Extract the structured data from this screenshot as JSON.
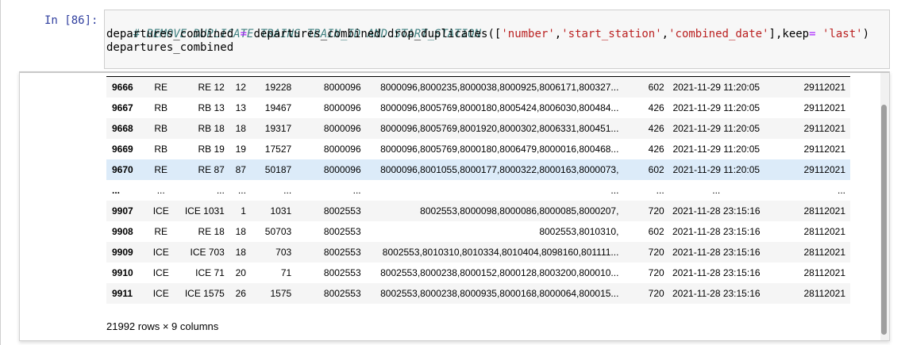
{
  "cell": {
    "prompt": "In [86]:",
    "code": {
      "comment": "# REMOVE DUPLICATE TRAINS TRAIN_ID AND START_STATION",
      "line2_var": "departures_combined",
      "line2_op": "=",
      "line2_call": "departures_combined.drop_duplicates([",
      "str_number": "'number'",
      "comma": ",",
      "str_start_station": "'start_station'",
      "str_combined_date": "'combined_date'",
      "line2_keep": "],keep",
      "str_last": "'last'",
      "close_paren": ")",
      "line3": "departures_combined"
    }
  },
  "table": {
    "rows": [
      {
        "idx": "9666",
        "c1": "RE",
        "c2": "RE 12",
        "c3": "12",
        "c4": "19228",
        "c5": "8000096",
        "c6": "8000096,8000235,8000038,8000925,8006171,800327...",
        "c7": "602",
        "c8": "2021-11-29 11:20:05",
        "c9": "29112021"
      },
      {
        "idx": "9667",
        "c1": "RB",
        "c2": "RB 13",
        "c3": "13",
        "c4": "19467",
        "c5": "8000096",
        "c6": "8000096,8005769,8000180,8005424,8006030,800484...",
        "c7": "426",
        "c8": "2021-11-29 11:20:05",
        "c9": "29112021"
      },
      {
        "idx": "9668",
        "c1": "RB",
        "c2": "RB 18",
        "c3": "18",
        "c4": "19317",
        "c5": "8000096",
        "c6": "8000096,8005769,8001920,8000302,8006331,800451...",
        "c7": "426",
        "c8": "2021-11-29 11:20:05",
        "c9": "29112021"
      },
      {
        "idx": "9669",
        "c1": "RB",
        "c2": "RB 19",
        "c3": "19",
        "c4": "17527",
        "c5": "8000096",
        "c6": "8000096,8005769,8000180,8006479,8000016,800468...",
        "c7": "426",
        "c8": "2021-11-29 11:20:05",
        "c9": "29112021"
      },
      {
        "idx": "9670",
        "c1": "RE",
        "c2": "RE 87",
        "c3": "87",
        "c4": "50187",
        "c5": "8000096",
        "c6": "8000096,8001055,8000177,8000322,8000163,8000073,",
        "c7": "602",
        "c8": "2021-11-29 11:20:05",
        "c9": "29112021"
      },
      {
        "idx": "...",
        "c1": "...",
        "c2": "...",
        "c3": "...",
        "c4": "...",
        "c5": "...",
        "c6": "...",
        "c7": "...",
        "c8": "...",
        "c9": "..."
      },
      {
        "idx": "9907",
        "c1": "ICE",
        "c2": "ICE 1031",
        "c3": "1",
        "c4": "1031",
        "c5": "8002553",
        "c6": "8002553,8000098,8000086,8000085,8000207,",
        "c7": "720",
        "c8": "2021-11-28 23:15:16",
        "c9": "28112021"
      },
      {
        "idx": "9908",
        "c1": "RE",
        "c2": "RE 18",
        "c3": "18",
        "c4": "50703",
        "c5": "8002553",
        "c6": "8002553,8010310,",
        "c7": "602",
        "c8": "2021-11-28 23:15:16",
        "c9": "28112021"
      },
      {
        "idx": "9909",
        "c1": "ICE",
        "c2": "ICE 703",
        "c3": "18",
        "c4": "703",
        "c5": "8002553",
        "c6": "8002553,8010310,8010334,8010404,8098160,801111...",
        "c7": "720",
        "c8": "2021-11-28 23:15:16",
        "c9": "28112021"
      },
      {
        "idx": "9910",
        "c1": "ICE",
        "c2": "ICE 71",
        "c3": "20",
        "c4": "71",
        "c5": "8002553",
        "c6": "8002553,8000238,8000152,8000128,8003200,800010...",
        "c7": "720",
        "c8": "2021-11-28 23:15:16",
        "c9": "28112021"
      },
      {
        "idx": "9911",
        "c1": "ICE",
        "c2": "ICE 1575",
        "c3": "26",
        "c4": "1575",
        "c5": "8002553",
        "c6": "8002553,8000238,8000935,8000168,8000064,800015...",
        "c7": "720",
        "c8": "2021-11-28 23:15:16",
        "c9": "28112021"
      }
    ],
    "shape": "21992 rows × 9 columns"
  },
  "colors": {
    "prompt": "#303f9f",
    "comment": "#408080",
    "string": "#ba2121",
    "operator": "#aa22ff",
    "row_stripe": "#f5f5f5",
    "row_hover": "#dcebf9"
  }
}
